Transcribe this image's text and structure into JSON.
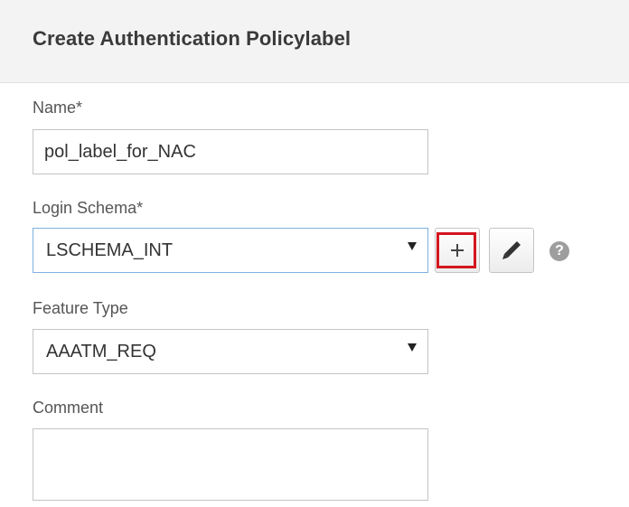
{
  "header": {
    "title": "Create Authentication Policylabel"
  },
  "form": {
    "name": {
      "label": "Name*",
      "value": "pol_label_for_NAC"
    },
    "login_schema": {
      "label": "Login Schema*",
      "selected": "LSCHEMA_INT",
      "add_icon": "plus-icon",
      "edit_icon": "pencil-icon",
      "help_icon": "question-icon",
      "help_glyph": "?"
    },
    "feature_type": {
      "label": "Feature Type",
      "selected": "AAATM_REQ"
    },
    "comment": {
      "label": "Comment",
      "value": ""
    }
  },
  "colors": {
    "header_bg": "#f3f3f3",
    "highlight": "#d4161f",
    "focus_border": "#7fb0e0",
    "help_icon": "#9e9e9e"
  }
}
